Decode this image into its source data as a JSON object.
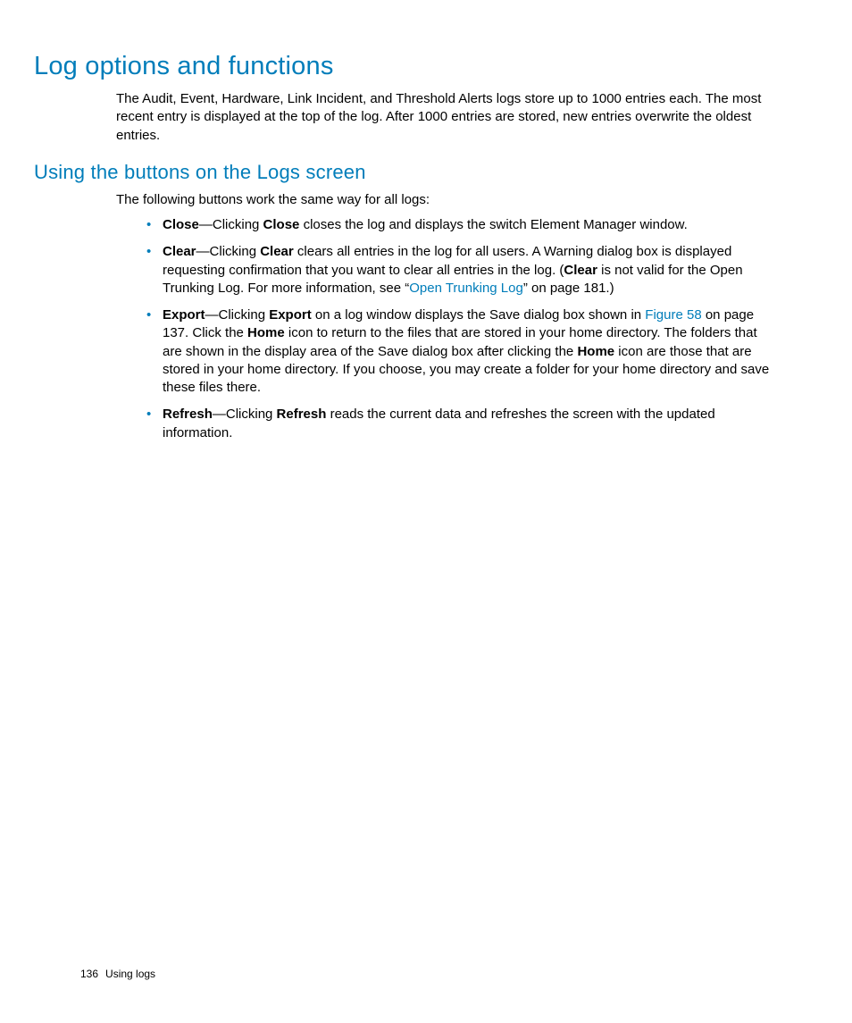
{
  "heading1": "Log options and functions",
  "intro1": "The Audit, Event, Hardware, Link Incident, and Threshold Alerts logs store up to 1000 entries each. The most recent entry is displayed at the top of the log. After 1000 entries are stored, new entries overwrite the oldest entries.",
  "heading2": "Using the buttons on the Logs screen",
  "intro2": "The following buttons work the same way for all logs:",
  "buttons": {
    "close": {
      "name": "Close",
      "dash": "—Clicking ",
      "name2": "Close",
      "rest": " closes the log and displays the switch Element Manager window."
    },
    "clear": {
      "name": "Clear",
      "dash": "—Clicking ",
      "name2": "Clear",
      "rest1": " clears all entries in the log for all users. A Warning dialog box is displayed requesting confirmation that you want to clear all entries in the log. (",
      "name3": "Clear",
      "rest2": " is not valid for the Open Trunking Log. For more information, see “",
      "link": "Open Trunking Log",
      "rest3": "” on page 181.)"
    },
    "export": {
      "name": "Export",
      "dash": "—Clicking ",
      "name2": "Export",
      "rest1": " on a log window displays the Save dialog box shown in ",
      "link": "Figure 58",
      "rest2": " on page 137. Click the ",
      "home1": "Home",
      "rest3": " icon to return to the files that are stored in your home directory. The folders that are shown in the display area of the Save dialog box after clicking the ",
      "home2": "Home",
      "rest4": " icon are those that are stored in your home directory. If you choose, you may create a folder for your home directory and save these files there."
    },
    "refresh": {
      "name": "Refresh",
      "dash": "—Clicking ",
      "name2": "Refresh",
      "rest": " reads the current data and refreshes the screen with the updated information."
    }
  },
  "footer": {
    "pagenum": "136",
    "section": "Using logs"
  }
}
